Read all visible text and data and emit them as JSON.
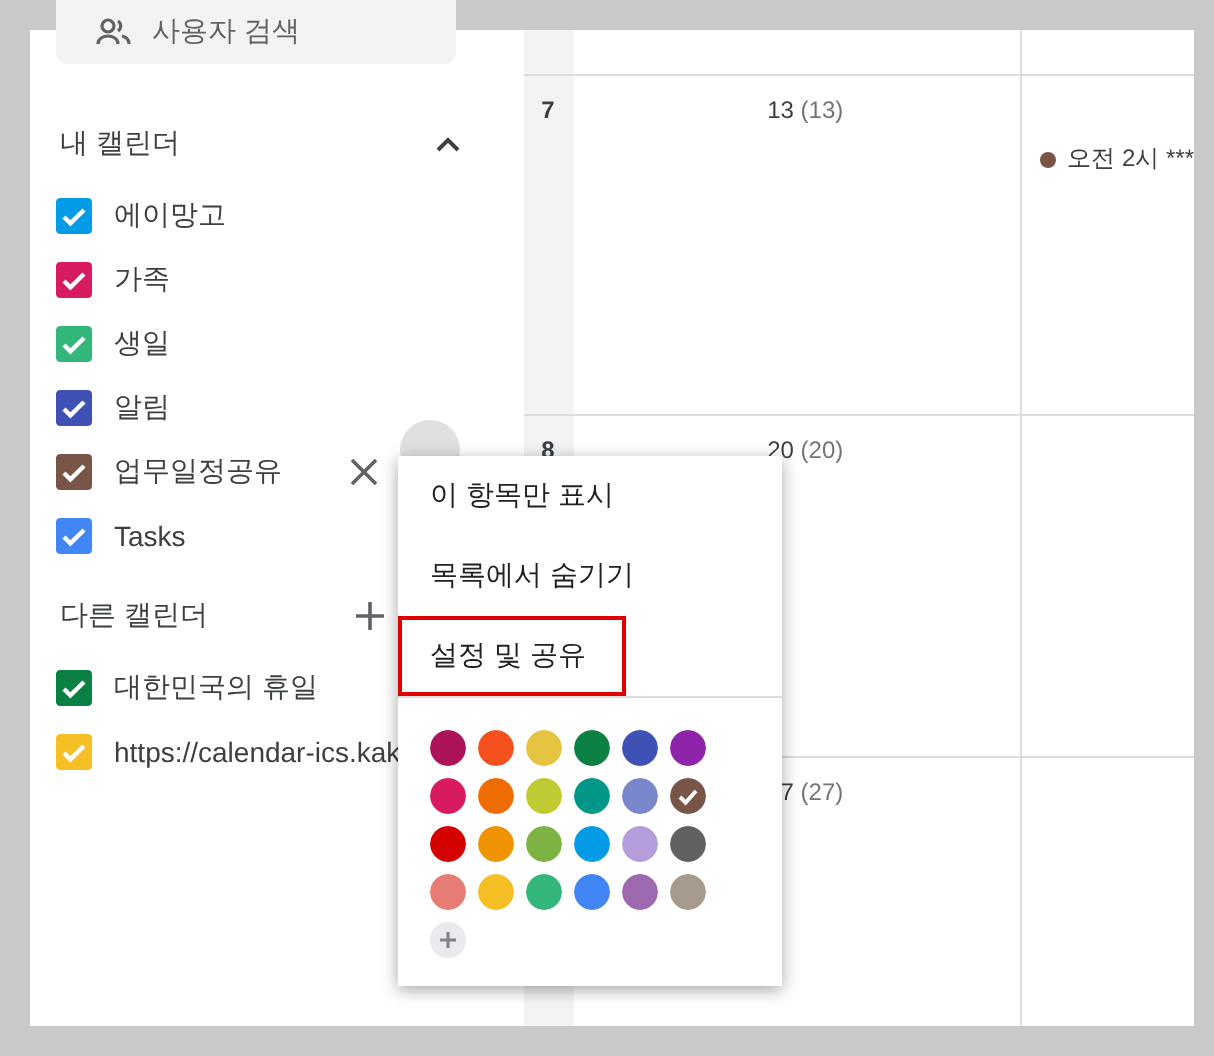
{
  "sidebar": {
    "search": {
      "placeholder": "사용자 검색"
    },
    "my_calendars": {
      "title": "내 캘린더",
      "expanded": true,
      "items": [
        {
          "label": "에이망고",
          "checked": true,
          "color": "#039be5",
          "hovered": false
        },
        {
          "label": "가족",
          "checked": true,
          "color": "#d81b60",
          "hovered": false
        },
        {
          "label": "생일",
          "checked": true,
          "color": "#33b679",
          "hovered": false
        },
        {
          "label": "알림",
          "checked": true,
          "color": "#3f51b5",
          "hovered": false
        },
        {
          "label": "업무일정공유",
          "checked": true,
          "color": "#795548",
          "hovered": true
        },
        {
          "label": "Tasks",
          "checked": true,
          "color": "#4285f4",
          "hovered": false
        }
      ]
    },
    "other_calendars": {
      "title": "다른 캘린더",
      "items": [
        {
          "label": "대한민국의 휴일",
          "checked": true,
          "color": "#0b8043",
          "hovered": false
        },
        {
          "label": "https://calendar-ics.kak",
          "checked": true,
          "color": "#f6bf26",
          "hovered": false
        }
      ]
    }
  },
  "calendar": {
    "weeks": [
      {
        "number": "7",
        "date": "13",
        "lunar": "(13)",
        "events": [
          {
            "text": "오전 2시 ***",
            "color": "#795548"
          }
        ]
      },
      {
        "number": "8",
        "date": "20",
        "lunar": "(20)"
      },
      {
        "date": "7",
        "lunar": "(27)"
      }
    ]
  },
  "context_menu": {
    "items": [
      {
        "label": "이 항목만 표시",
        "highlighted": false
      },
      {
        "label": "목록에서 숨기기",
        "highlighted": false
      },
      {
        "label": "설정 및 공유",
        "highlighted": true
      }
    ],
    "colors": [
      {
        "color": "#ad1457",
        "selected": false
      },
      {
        "color": "#f4511e",
        "selected": false
      },
      {
        "color": "#e4c441",
        "selected": false
      },
      {
        "color": "#0b8043",
        "selected": false
      },
      {
        "color": "#3f51b5",
        "selected": false
      },
      {
        "color": "#8e24aa",
        "selected": false
      },
      {
        "color": "#d81b60",
        "selected": false
      },
      {
        "color": "#ef6c00",
        "selected": false
      },
      {
        "color": "#c0ca33",
        "selected": false
      },
      {
        "color": "#009688",
        "selected": false
      },
      {
        "color": "#7986cb",
        "selected": false
      },
      {
        "color": "#795548",
        "selected": true
      },
      {
        "color": "#d50000",
        "selected": false
      },
      {
        "color": "#f09300",
        "selected": false
      },
      {
        "color": "#7cb342",
        "selected": false
      },
      {
        "color": "#039be5",
        "selected": false
      },
      {
        "color": "#b39ddb",
        "selected": false
      },
      {
        "color": "#616161",
        "selected": false
      },
      {
        "color": "#e67c73",
        "selected": false
      },
      {
        "color": "#f6bf26",
        "selected": false
      },
      {
        "color": "#33b679",
        "selected": false
      },
      {
        "color": "#4285f4",
        "selected": false
      },
      {
        "color": "#9e69af",
        "selected": false
      },
      {
        "color": "#a79b8e",
        "selected": false
      }
    ]
  }
}
